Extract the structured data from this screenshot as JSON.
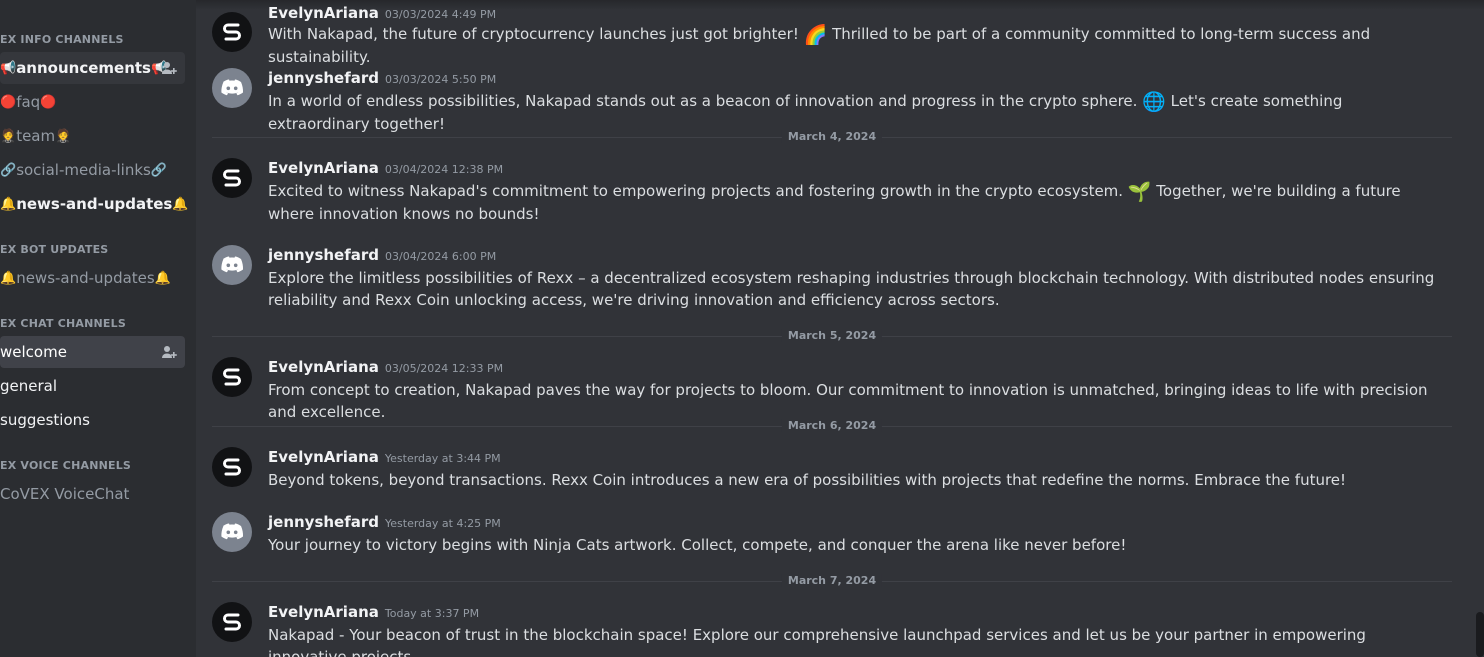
{
  "sidebar": {
    "categories": {
      "info": "EX INFO CHANNELS",
      "bot": "EX BOT UPDATES",
      "chat": "EX CHAT CHANNELS",
      "voice": "EX VOICE CHANNELS"
    },
    "channels": {
      "announcements": "announcements",
      "faq": "faq",
      "team": "team",
      "social": "social-media-links",
      "news": "news-and-updates",
      "bot_news": "news-and-updates",
      "welcome": "welcome",
      "general": "general",
      "suggestions": "suggestions",
      "voice": "CoVEX VoiceChat"
    }
  },
  "dividers": {
    "d1": "March 4, 2024",
    "d2": "March 5, 2024",
    "d3": "March 6, 2024",
    "d4": "March 7, 2024"
  },
  "messages": [
    {
      "author": "EvelynAriana",
      "time": "03/03/2024 4:49 PM",
      "text_a": "With Nakapad, the future of cryptocurrency launches just got brighter!",
      "emoji": "🌈",
      "text_b": "Thrilled to be part of a community committed to long-term success and sustainability."
    },
    {
      "author": "jennyshefard",
      "time": "03/03/2024 5:50 PM",
      "text_a": "In a world of endless possibilities, Nakapad stands out as a beacon of innovation and progress in the crypto sphere.",
      "emoji": "🌐",
      "text_b": "Let's create something extraordinary together!"
    },
    {
      "author": "EvelynAriana",
      "time": "03/04/2024 12:38 PM",
      "text_a": "Excited to witness Nakapad's commitment to empowering projects and fostering growth in the crypto ecosystem.",
      "emoji": "🌱",
      "text_b": "Together, we're building a future where innovation knows no bounds!"
    },
    {
      "author": "jennyshefard",
      "time": "03/04/2024 6:00 PM",
      "text_a": "Explore the limitless possibilities of Rexx – a decentralized ecosystem reshaping industries through blockchain technology. With distributed nodes ensuring reliability and Rexx Coin unlocking access, we're driving innovation and efficiency across sectors."
    },
    {
      "author": "EvelynAriana",
      "time": "03/05/2024 12:33 PM",
      "text_a": "From concept to creation, Nakapad paves the way for projects to bloom. Our commitment to innovation is unmatched, bringing ideas to life with precision and excellence."
    },
    {
      "author": "EvelynAriana",
      "time": "Yesterday at 3:44 PM",
      "text_a": "Beyond tokens, beyond transactions. Rexx Coin introduces a new era of possibilities with projects that redefine the norms. Embrace the future!"
    },
    {
      "author": "jennyshefard",
      "time": "Yesterday at 4:25 PM",
      "text_a": "Your journey to victory begins with Ninja Cats artwork. Collect, compete, and conquer the arena like never before!"
    },
    {
      "author": "EvelynAriana",
      "time": "Today at 3:37 PM",
      "text_a": "Nakapad - Your beacon of trust in the blockchain space! Explore our comprehensive launchpad services and let us be your partner in empowering innovative projects."
    }
  ],
  "icons": {
    "evelyn_avatar": "swirl-logo-icon",
    "jenny_avatar": "discord-default-avatar-icon",
    "add_member": "add-member-icon"
  },
  "colors": {
    "background": "#313338",
    "sidebar": "#2b2d31",
    "selected": "#404249"
  }
}
